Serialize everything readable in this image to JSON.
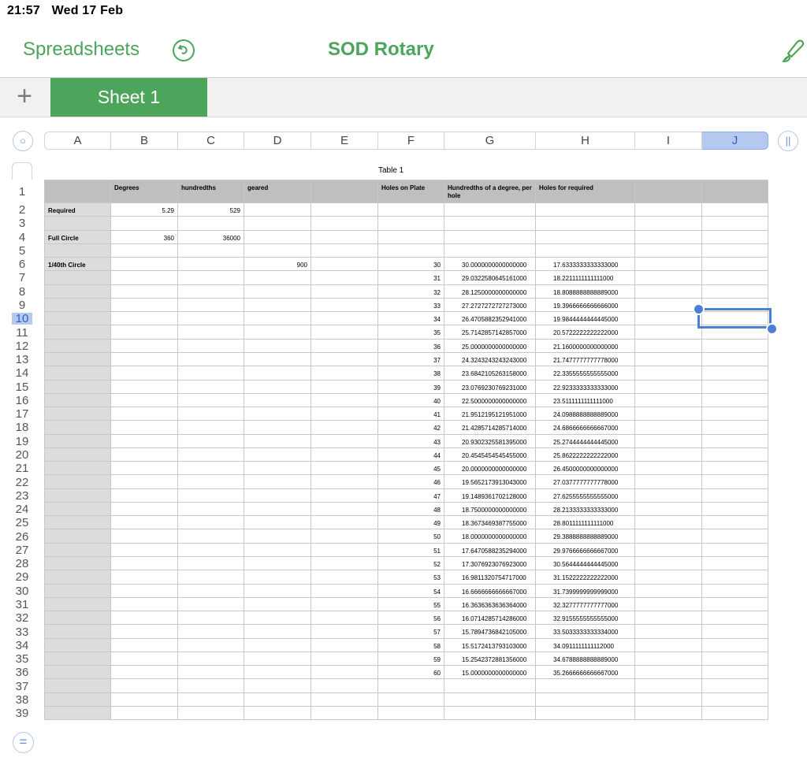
{
  "status": {
    "time": "21:57",
    "date": "Wed 17 Feb"
  },
  "toolbar": {
    "back_label": "Spreadsheets",
    "title": "SOD Rotary",
    "undo_icon": "undo-icon",
    "brush_icon": "paintbrush-icon"
  },
  "tabs": {
    "add_icon": "plus-icon",
    "sheets": [
      "Sheet 1"
    ]
  },
  "columns": [
    "A",
    "B",
    "C",
    "D",
    "E",
    "F",
    "G",
    "H",
    "I",
    "J"
  ],
  "selected_column": "J",
  "selected_row": 10,
  "table": {
    "caption": "Table 1",
    "headers": [
      "",
      "Degrees",
      "hundredths",
      "geared",
      "",
      "Holes on Plate",
      "Hundredths  of a  degree, per hole",
      "Holes for required",
      "",
      ""
    ],
    "row_labels": {
      "2": "Required",
      "4": "Full Circle",
      "6": "1/40th Circle"
    },
    "fixed_cells": {
      "2": {
        "B": "5.29",
        "C": "529"
      },
      "4": {
        "B": "360",
        "C": "36000"
      },
      "6": {
        "D": "900"
      }
    },
    "holes": [
      "30",
      "31",
      "32",
      "33",
      "34",
      "35",
      "36",
      "37",
      "38",
      "39",
      "40",
      "41",
      "42",
      "43",
      "44",
      "45",
      "46",
      "47",
      "48",
      "49",
      "50",
      "51",
      "52",
      "53",
      "54",
      "55",
      "56",
      "57",
      "58",
      "59",
      "60"
    ],
    "per_hole": [
      "30.0000000000000000",
      "29.0322580645161000",
      "28.1250000000000000",
      "27.2727272727273000",
      "26.4705882352941000",
      "25.7142857142857000",
      "25.0000000000000000",
      "24.3243243243243000",
      "23.6842105263158000",
      "23.0769230769231000",
      "22.5000000000000000",
      "21.9512195121951000",
      "21.4285714285714000",
      "20.9302325581395000",
      "20.4545454545455000",
      "20.0000000000000000",
      "19.5652173913043000",
      "19.1489361702128000",
      "18.7500000000000000",
      "18.3673469387755000",
      "18.0000000000000000",
      "17.6470588235294000",
      "17.3076923076923000",
      "16.9811320754717000",
      "16.6666666666667000",
      "16.3636363636364000",
      "16.0714285714286000",
      "15.7894736842105000",
      "15.5172413793103000",
      "15.2542372881356000",
      "15.0000000000000000"
    ],
    "holes_required": [
      "17.6333333333333000",
      "18.2211111111111000",
      "18.8088888888889000",
      "19.3966666666666000",
      "19.9844444444445000",
      "20.5722222222222000",
      "21.1600000000000000",
      "21.7477777777778000",
      "22.3355555555555000",
      "22.9233333333333000",
      "23.5111111111111000",
      "24.0988888888889000",
      "24.6866666666667000",
      "25.2744444444445000",
      "25.8622222222222000",
      "26.4500000000000000",
      "27.0377777777778000",
      "27.6255555555555000",
      "28.2133333333333000",
      "28.8011111111111000",
      "29.3888888888889000",
      "29.9766666666667000",
      "30.5644444444445000",
      "31.1522222222222000",
      "31.7399999999999000",
      "32.3277777777777000",
      "32.9155555555555000",
      "33.5033333333334000",
      "34.0911111111112000",
      "34.6788888888889000",
      "35.2666666666667000"
    ]
  },
  "bottom": {
    "formula_icon": "equals-icon"
  }
}
